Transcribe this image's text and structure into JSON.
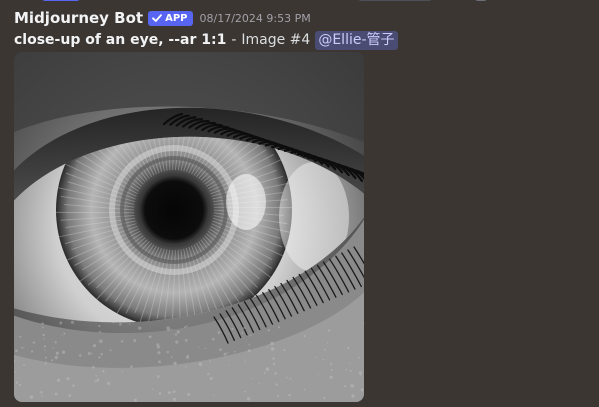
{
  "message": {
    "author": "Midjourney Bot",
    "badge": {
      "icon": "checkmark-icon",
      "label": "APP",
      "color": "#5865f2"
    },
    "timestamp": "08/17/2024 9:53 PM",
    "prompt": "close-up of an eye, --ar 1:1",
    "separator": "-",
    "image_label": "Image #4",
    "mention": "@Ellie-管子",
    "attachment": {
      "alt": "",
      "subject": "black and white macro of a human eye"
    }
  },
  "colors": {
    "background": "#3b3632",
    "username": "#f2f3f5",
    "text": "#dbdee1",
    "timestamp": "#a3a0a8",
    "mention_bg": "#4a4c73",
    "mention_text": "#c9cdfb"
  }
}
